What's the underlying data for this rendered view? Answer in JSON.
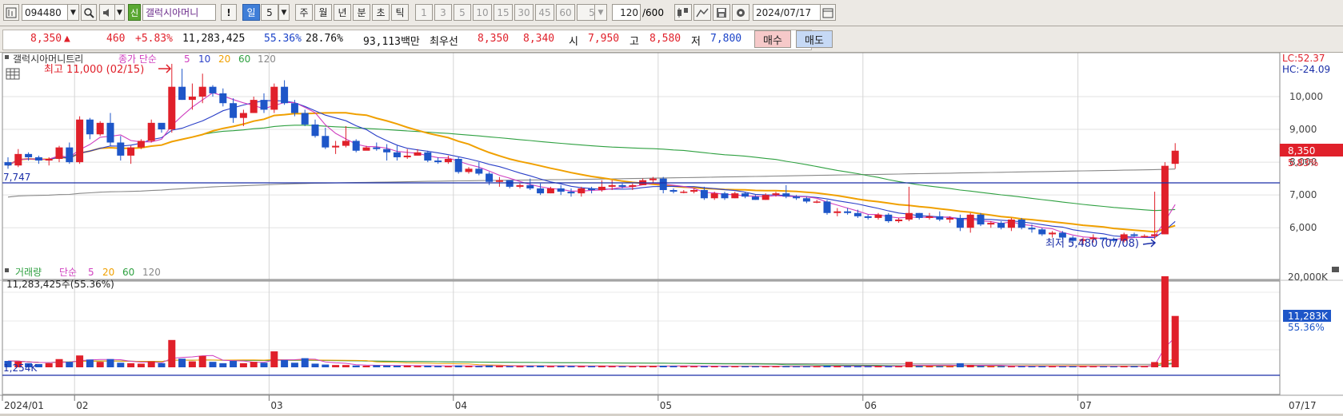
{
  "toolbar": {
    "code": "094480",
    "badge": "신",
    "stock_name": "갤럭시아머니",
    "excl": "!",
    "periods": [
      {
        "label": "일",
        "selected": true
      },
      {
        "label": "5",
        "selected": false
      },
      {
        "label": "주",
        "selected": false
      },
      {
        "label": "월",
        "selected": false
      },
      {
        "label": "년",
        "selected": false
      },
      {
        "label": "분",
        "selected": false
      },
      {
        "label": "초",
        "selected": false
      },
      {
        "label": "틱",
        "selected": false
      }
    ],
    "intervals": [
      "1",
      "3",
      "5",
      "10",
      "15",
      "30",
      "45",
      "60"
    ],
    "interval_value": "5",
    "count": "120",
    "count_max": "/600",
    "date": "2024/07/17"
  },
  "quote": {
    "price": "8,350",
    "change": "460",
    "change_pct": "+5.83%",
    "volume": "11,283,425",
    "vol_ratio": "55.36%",
    "turnover": "28.76%",
    "amount": "93,113백만",
    "best_label": "최우선",
    "ask": "8,350",
    "bid": "8,340",
    "open_label": "시",
    "open": "7,950",
    "high_label": "고",
    "high": "8,580",
    "low_label": "저",
    "low": "7,800",
    "buy_label": "매수",
    "sell_label": "매도"
  },
  "price_legend": {
    "name": "갤럭시아머니트리",
    "ma_label": "종가 단순",
    "periods": [
      "5",
      "10",
      "20",
      "60",
      "120"
    ],
    "max_label": "최고 11,000 (02/15)",
    "min_label": "최저 5,480 (07/08)",
    "level_label": "7,747",
    "lc": "LC:52.37",
    "hc": "HC:-24.09",
    "last_price": "8,350",
    "last_pct": "5.83%",
    "y_ticks": [
      "10,000",
      "9,000",
      "8,000",
      "7,000",
      "6,000"
    ]
  },
  "volume_legend": {
    "name": "거래량",
    "ma_label": "단순",
    "periods": [
      "5",
      "20",
      "60",
      "120"
    ],
    "info": "11,283,425주(55.36%)",
    "level_label": "1,254K",
    "y_tick": "20,000K",
    "last_vol": "11,283K",
    "last_pct": "55.36%"
  },
  "x_axis": {
    "labels": [
      "2024/01",
      "02",
      "03",
      "04",
      "05",
      "06",
      "07"
    ],
    "end_label": "07/17"
  },
  "colors": {
    "up": "#e0202a",
    "down": "#1e56c8",
    "ma5": "#d040c0",
    "ma10": "#2a3fc8",
    "ma20": "#f0a000",
    "ma60": "#2ea040",
    "ma120": "#888888"
  },
  "chart_data": {
    "type": "candlestick",
    "candles": [
      [
        8000,
        8150,
        7800,
        7900
      ],
      [
        7900,
        8400,
        7850,
        8250
      ],
      [
        8250,
        8300,
        8050,
        8150
      ],
      [
        8150,
        8200,
        7950,
        8050
      ],
      [
        8050,
        8150,
        7900,
        8100
      ],
      [
        8100,
        8500,
        8000,
        8450
      ],
      [
        8450,
        8600,
        7950,
        8000
      ],
      [
        8000,
        9400,
        7950,
        9300
      ],
      [
        9300,
        9350,
        8700,
        8850
      ],
      [
        8850,
        9250,
        8800,
        9200
      ],
      [
        9200,
        9500,
        8500,
        8600
      ],
      [
        8600,
        8800,
        8050,
        8200
      ],
      [
        8200,
        8500,
        7950,
        8450
      ],
      [
        8450,
        8700,
        8400,
        8650
      ],
      [
        8650,
        9300,
        8600,
        9200
      ],
      [
        9200,
        9150,
        8900,
        9000
      ],
      [
        9000,
        11000,
        8900,
        10300
      ],
      [
        10300,
        10850,
        9900,
        9900
      ],
      [
        9900,
        10400,
        9600,
        10000
      ],
      [
        10000,
        10700,
        9800,
        10300
      ],
      [
        10300,
        10350,
        10000,
        10100
      ],
      [
        10100,
        10250,
        9700,
        9800
      ],
      [
        9800,
        9950,
        9200,
        9350
      ],
      [
        9350,
        9600,
        9100,
        9500
      ],
      [
        9500,
        10000,
        9500,
        9900
      ],
      [
        9900,
        10100,
        9500,
        9600
      ],
      [
        9600,
        10400,
        9500,
        10300
      ],
      [
        10300,
        10500,
        9750,
        9800
      ],
      [
        9800,
        9900,
        9400,
        9500
      ],
      [
        9500,
        9600,
        9100,
        9150
      ],
      [
        9150,
        9300,
        8750,
        8800
      ],
      [
        8800,
        9050,
        8400,
        8450
      ],
      [
        8450,
        8650,
        8250,
        8500
      ],
      [
        8500,
        9100,
        8450,
        8650
      ],
      [
        8650,
        8700,
        8300,
        8350
      ],
      [
        8350,
        8500,
        8400,
        8450
      ],
      [
        8450,
        8600,
        8350,
        8400
      ],
      [
        8400,
        8550,
        8050,
        8300
      ],
      [
        8300,
        8500,
        8050,
        8150
      ],
      [
        8150,
        8400,
        8100,
        8200
      ],
      [
        8200,
        8400,
        8200,
        8300
      ],
      [
        8300,
        8350,
        8000,
        8050
      ],
      [
        8050,
        8150,
        7950,
        8000
      ],
      [
        8000,
        8200,
        7950,
        8100
      ],
      [
        8100,
        8150,
        7650,
        7700
      ],
      [
        7700,
        7850,
        7650,
        7800
      ],
      [
        7800,
        8000,
        7600,
        7650
      ],
      [
        7650,
        7700,
        7300,
        7400
      ],
      [
        7400,
        7550,
        7250,
        7450
      ],
      [
        7450,
        7450,
        7200,
        7250
      ],
      [
        7250,
        7350,
        7200,
        7300
      ],
      [
        7300,
        7500,
        7150,
        7200
      ],
      [
        7200,
        7350,
        7000,
        7050
      ],
      [
        7050,
        7250,
        7050,
        7200
      ],
      [
        7200,
        7300,
        7000,
        7100
      ],
      [
        7100,
        7200,
        6950,
        7050
      ],
      [
        7050,
        7250,
        6950,
        7200
      ],
      [
        7200,
        7250,
        7050,
        7150
      ],
      [
        7150,
        7450,
        7100,
        7250
      ],
      [
        7250,
        7450,
        7150,
        7300
      ],
      [
        7300,
        7350,
        7200,
        7250
      ],
      [
        7250,
        7350,
        7150,
        7300
      ],
      [
        7300,
        7500,
        7300,
        7450
      ],
      [
        7450,
        7550,
        7350,
        7500
      ],
      [
        7500,
        7550,
        7050,
        7150
      ],
      [
        7150,
        7200,
        7050,
        7100
      ],
      [
        7100,
        7150,
        7050,
        7100
      ],
      [
        7100,
        7200,
        7050,
        7150
      ],
      [
        7150,
        7250,
        6850,
        6900
      ],
      [
        6900,
        7100,
        6850,
        7050
      ],
      [
        7050,
        7100,
        6850,
        6900
      ],
      [
        6900,
        7100,
        6900,
        7050
      ],
      [
        7050,
        7100,
        6900,
        6950
      ],
      [
        6950,
        7000,
        6850,
        6850
      ],
      [
        6850,
        7050,
        6850,
        7000
      ],
      [
        7000,
        7100,
        6950,
        7050
      ],
      [
        7050,
        7300,
        6900,
        6950
      ],
      [
        6950,
        7000,
        6850,
        6900
      ],
      [
        6900,
        6950,
        6750,
        6800
      ],
      [
        6800,
        6850,
        6750,
        6800
      ],
      [
        6800,
        6850,
        6400,
        6450
      ],
      [
        6450,
        6600,
        6350,
        6500
      ],
      [
        6500,
        6600,
        6400,
        6450
      ],
      [
        6450,
        6550,
        6300,
        6350
      ],
      [
        6350,
        6400,
        6250,
        6300
      ],
      [
        6300,
        6450,
        6250,
        6400
      ],
      [
        6400,
        6450,
        6150,
        6200
      ],
      [
        6200,
        6300,
        6150,
        6250
      ],
      [
        6250,
        7250,
        6200,
        6450
      ],
      [
        6450,
        6450,
        6250,
        6300
      ],
      [
        6300,
        6450,
        6250,
        6350
      ],
      [
        6350,
        6500,
        6200,
        6250
      ],
      [
        6250,
        6350,
        6150,
        6300
      ],
      [
        6300,
        6400,
        5900,
        6000
      ],
      [
        6000,
        6450,
        5850,
        6400
      ],
      [
        6400,
        6450,
        6050,
        6100
      ],
      [
        6100,
        6200,
        6000,
        6150
      ],
      [
        6150,
        6200,
        5950,
        6000
      ],
      [
        6000,
        6300,
        5900,
        6250
      ],
      [
        6250,
        6300,
        5950,
        6000
      ],
      [
        6000,
        6100,
        5850,
        5950
      ],
      [
        5950,
        6000,
        5750,
        5800
      ],
      [
        5800,
        5900,
        5700,
        5850
      ],
      [
        5850,
        5900,
        5650,
        5700
      ],
      [
        5700,
        5750,
        5500,
        5600
      ],
      [
        5600,
        5700,
        5480,
        5650
      ],
      [
        5650,
        5800,
        5550,
        5700
      ],
      [
        5700,
        5700,
        5600,
        5650
      ],
      [
        5650,
        5700,
        5550,
        5600
      ],
      [
        5600,
        5850,
        5550,
        5800
      ],
      [
        5800,
        5850,
        5700,
        5750
      ],
      [
        5750,
        5800,
        5700,
        5750
      ],
      [
        5750,
        7100,
        5650,
        5800
      ],
      [
        5800,
        8000,
        5800,
        7890
      ],
      [
        7950,
        8580,
        7800,
        8350
      ]
    ],
    "volumes": [
      1400,
      1300,
      900,
      700,
      900,
      1800,
      1200,
      2600,
      1700,
      1200,
      1800,
      1000,
      900,
      800,
      1300,
      900,
      6000,
      1900,
      1300,
      2500,
      1200,
      900,
      1400,
      900,
      1200,
      1000,
      3500,
      1600,
      1000,
      2000,
      800,
      600,
      500,
      500,
      400,
      350,
      450,
      400,
      350,
      380,
      300,
      350,
      300,
      250,
      400,
      300,
      280,
      400,
      300,
      250,
      250,
      300,
      350,
      250,
      300,
      280,
      250,
      260,
      300,
      250,
      200,
      220,
      250,
      300,
      350,
      300,
      250,
      240,
      250,
      260,
      200,
      210,
      250,
      230,
      200,
      220,
      260,
      210,
      230,
      240,
      350,
      300,
      250,
      260,
      240,
      300,
      250,
      260,
      1200,
      300,
      280,
      260,
      240,
      900,
      500,
      300,
      250,
      260,
      240,
      250,
      230,
      250,
      240,
      200,
      230,
      220,
      210,
      200,
      190,
      250,
      260,
      240,
      1150,
      20000,
      11283
    ]
  }
}
